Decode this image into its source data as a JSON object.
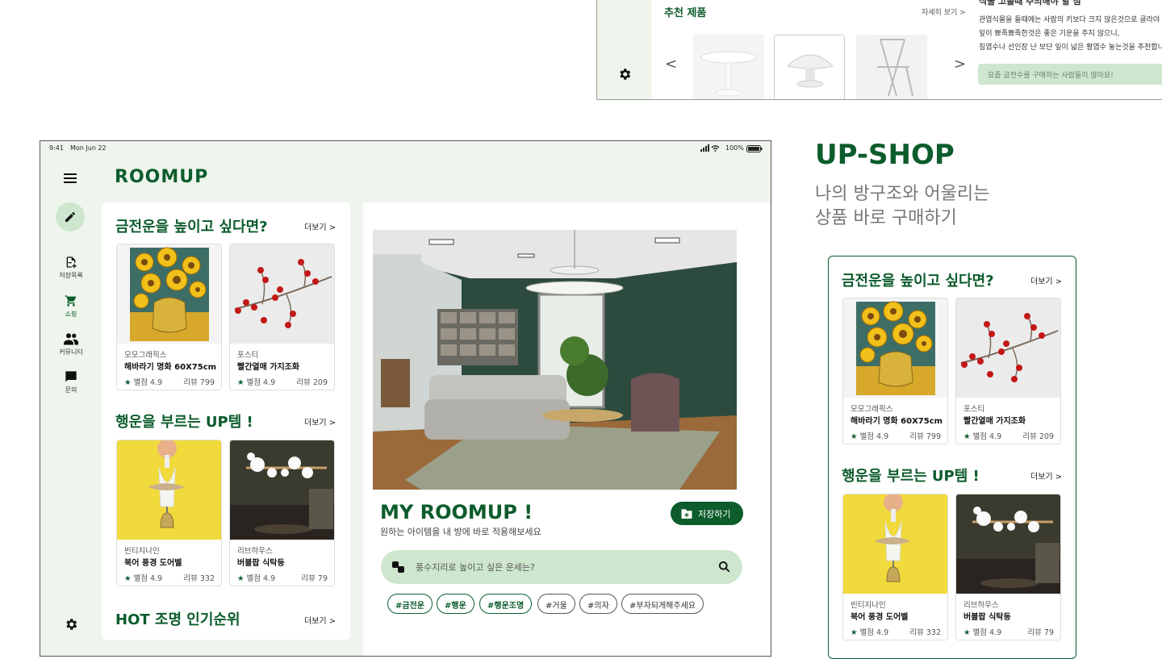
{
  "top_fragment": {
    "recommend_title": "추천 제품",
    "recommend_more": "자세히 보기 >",
    "prev_arrow": "<",
    "next_arrow": ">",
    "desc_title": "식물 고를때 주의해야 할 점",
    "desc_lines": [
      "관엽식물을 들때에는 사람의 키보다 크지 않은것으로 골라야 합니다.",
      "잎이 뾰족뾰족한것은 좋은 기운을 주지 않으니,",
      "침엽수나 선인장 난 보단 잎이 넓은 활엽수 놓는것을 추천합니다."
    ],
    "hint": "요즘 금전수를 구매하는 사람들이 많아요!"
  },
  "status_bar": {
    "time": "9:41",
    "date": "Mon Jun 22",
    "battery": "100%"
  },
  "app": {
    "logo": "ROOMUP"
  },
  "sidebar": {
    "items": [
      {
        "label": "저장목록",
        "icon": "save-list-icon"
      },
      {
        "label": "쇼핑",
        "icon": "cart-icon",
        "active": true
      },
      {
        "label": "커뮤니티",
        "icon": "people-icon"
      },
      {
        "label": "문의",
        "icon": "chat-icon"
      }
    ]
  },
  "sections": [
    {
      "title": "금전운을 높이고 싶다면?",
      "more": "더보기 >",
      "products": [
        {
          "brand": "모모그래픽스",
          "name": "해바라기 명화 60X75cm",
          "rating": "별점 4.9",
          "reviews": "리뷰 799"
        },
        {
          "brand": "포스티",
          "name": "빨간열매 가지조화",
          "rating": "별점 4.9",
          "reviews": "리뷰 209"
        }
      ]
    },
    {
      "title": "행운을 부르는 UP템 !",
      "more": "더보기 >",
      "products": [
        {
          "brand": "빈티지나인",
          "name": "북어 풍경 도어벨",
          "rating": "별점 4.9",
          "reviews": "리뷰 332"
        },
        {
          "brand": "리브하우스",
          "name": "버블팝 식탁등",
          "rating": "별점 4.9",
          "reviews": "리뷰 79"
        }
      ]
    },
    {
      "title": "HOT 조명 인기순위",
      "more": "더보기 >"
    }
  ],
  "main": {
    "title": "MY ROOMUP !",
    "subtitle": "원하는 아이템을 내 방에 바로 적용해보세요",
    "save_button": "저장하기",
    "search_placeholder": "풍수지리로 높이고 싶은 운세는?",
    "tags": [
      "#금전운",
      "#행운",
      "#행운조명",
      "#거울",
      "#의자",
      "#부자되게해주세요"
    ]
  },
  "upshop": {
    "title": "UP-SHOP",
    "subtitle_line1": "나의 방구조와 어울리는",
    "subtitle_line2": "상품 바로 구매하기"
  },
  "colors": {
    "brand_green": "#0c5c2c",
    "mint_bg": "#eef5ec",
    "search_bg": "#cde6cd"
  }
}
